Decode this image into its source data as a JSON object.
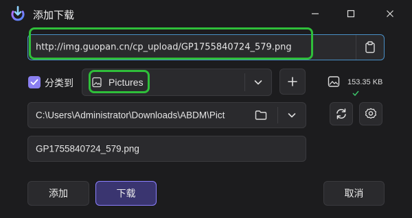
{
  "window": {
    "title": "添加下载"
  },
  "colors": {
    "accent": "#8a7ff0",
    "highlight": "#2fbf3a",
    "background": "#1c1c1e"
  },
  "url": {
    "value": "http://img.guopan.cn/cp_upload/GP1755840724_579.png"
  },
  "category": {
    "checkbox_label": "分类到",
    "checked": true,
    "selected": "Pictures"
  },
  "file": {
    "size": "153.35 KB"
  },
  "save_path": {
    "value": "C:\\Users\\Administrator\\Downloads\\ABDM\\Pict"
  },
  "filename": {
    "value": "GP1755840724_579.png"
  },
  "actions": {
    "add": "添加",
    "download": "下载",
    "cancel": "取消"
  },
  "icons": {
    "logo": "download-logo-icon",
    "minimize": "minimize-icon",
    "maximize": "maximize-icon",
    "close": "close-icon",
    "paste": "clipboard-icon",
    "category": "image-file-icon",
    "dropdown": "chevron-down-icon",
    "add_category": "plus-icon",
    "file_type": "image-icon",
    "status": "check-icon",
    "folder": "folder-icon",
    "refresh": "refresh-icon",
    "settings": "gear-icon"
  }
}
